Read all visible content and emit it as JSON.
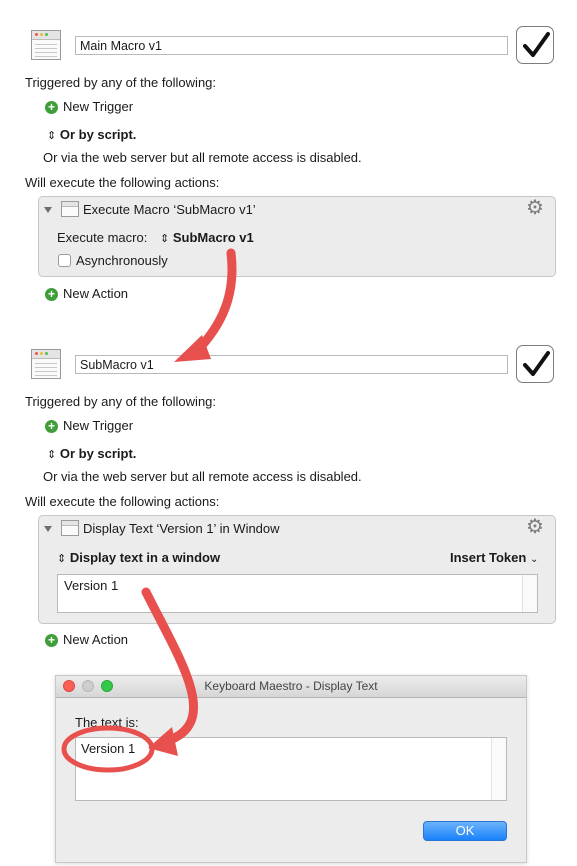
{
  "macro1": {
    "name": "Main Macro v1",
    "triggered_label": "Triggered by any of the following:",
    "new_trigger": "New Trigger",
    "or_by_script": "Or by script.",
    "web_server_note": "Or via the web server but all remote access is disabled.",
    "will_execute": "Will execute the following actions:",
    "action": {
      "title": "Execute Macro ‘SubMacro v1’",
      "execute_label": "Execute macro:",
      "selected_macro": "SubMacro v1",
      "async_label": "Asynchronously",
      "async_checked": false
    },
    "new_action": "New Action",
    "enabled": true
  },
  "macro2": {
    "name": "SubMacro v1",
    "triggered_label": "Triggered by any of the following:",
    "new_trigger": "New Trigger",
    "or_by_script": "Or by script.",
    "web_server_note": "Or via the web server but all remote access is disabled.",
    "will_execute": "Will execute the following actions:",
    "action": {
      "title": "Display Text ‘Version 1’ in Window",
      "mode": "Display text in a window",
      "insert_token": "Insert Token",
      "text_value": "Version 1"
    },
    "new_action": "New Action",
    "enabled": true
  },
  "dialog": {
    "title": "Keyboard Maestro - Display Text",
    "label": "The text is:",
    "text_value": "Version 1",
    "ok_label": "OK"
  },
  "colors": {
    "annotation_red": "#e8504d",
    "ok_blue": "#1a82fb",
    "plus_green": "#3f9e3a"
  },
  "icons": {
    "macro": "macro-window-icon",
    "checkmark": "checkmark-icon",
    "plus": "plus-circle-icon",
    "disclosure": "disclosure-triangle-icon",
    "gear": "gear-icon",
    "updown": "updown-chevron-icon",
    "chevron": "chevron-down-icon"
  }
}
